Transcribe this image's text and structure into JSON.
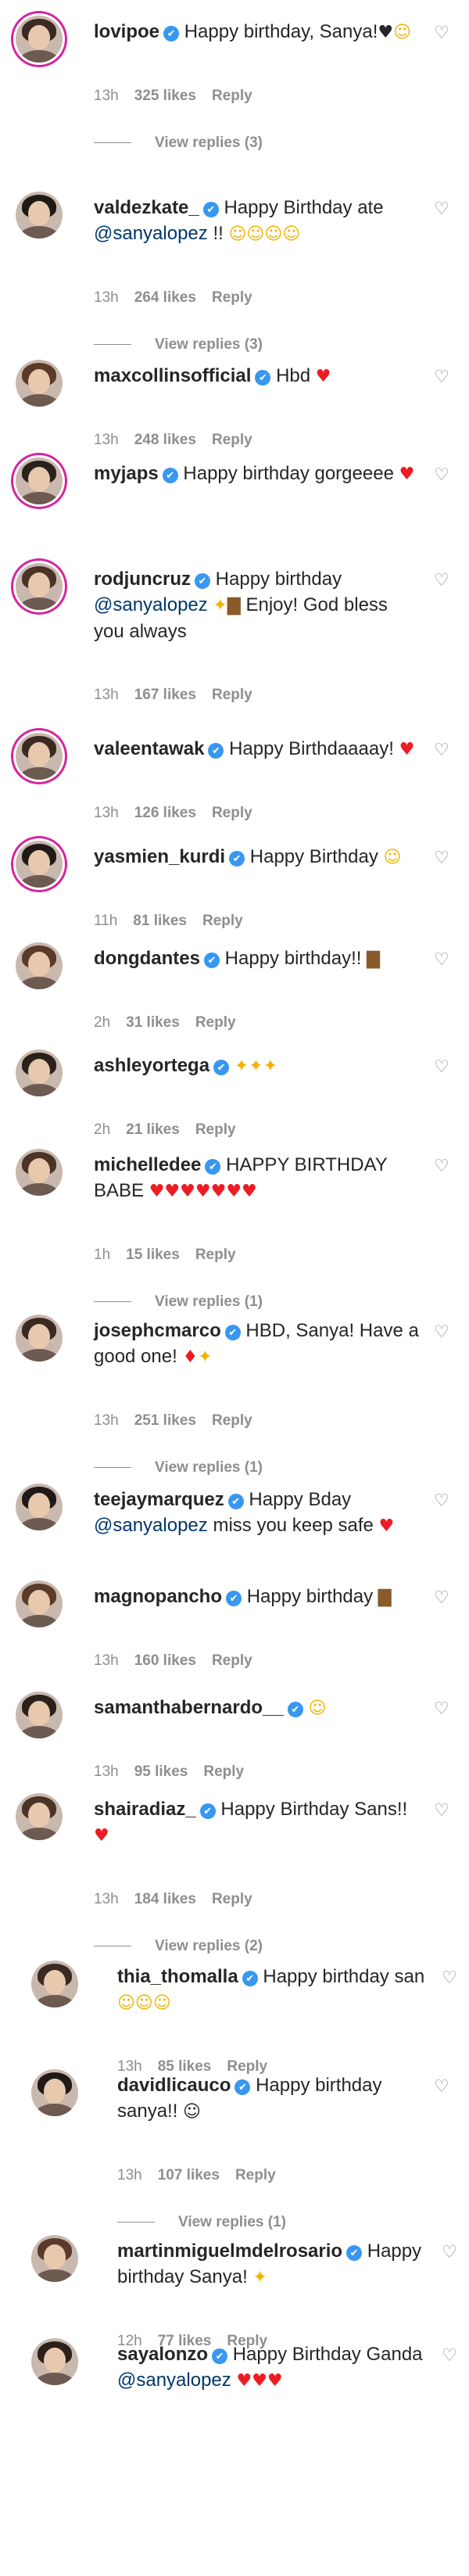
{
  "comments": [
    {
      "username": "lovipoe",
      "verified": true,
      "segments": [
        {
          "t": "Happy birthday, Sanya!"
        },
        {
          "t": "♥",
          "c": "emoji"
        },
        {
          "t": "☺",
          "c": "emoji yellow"
        }
      ],
      "time": "13h",
      "likes": "325 likes",
      "reply": "Reply",
      "view_replies": "View replies (3)"
    },
    {
      "username": "valdezkate_",
      "verified": true,
      "segments": [
        {
          "t": "Happy Birthday ate "
        },
        {
          "t": "@sanyalopez",
          "c": "mention"
        },
        {
          "t": " !! "
        },
        {
          "t": "☺☺☺☺",
          "c": "emoji yellow"
        }
      ],
      "time": "13h",
      "likes": "264 likes",
      "reply": "Reply",
      "view_replies": "View replies (3)"
    },
    {
      "username": "maxcollinsofficial",
      "verified": true,
      "segments": [
        {
          "t": "Hbd "
        },
        {
          "t": "♥",
          "c": "emoji red"
        }
      ],
      "time": "13h",
      "likes": "248 likes",
      "reply": "Reply"
    },
    {
      "username": "myjaps",
      "verified": true,
      "segments": [
        {
          "t": "Happy birthday gorgeeee "
        },
        {
          "t": "♥",
          "c": "emoji red"
        }
      ]
    },
    {
      "username": "rodjuncruz",
      "verified": true,
      "segments": [
        {
          "t": "Happy birthday "
        },
        {
          "t": "@sanyalopez",
          "c": "mention"
        },
        {
          "t": " "
        },
        {
          "t": "✦",
          "c": "emoji yellow"
        },
        {
          "t": "▇",
          "c": "emoji brown"
        },
        {
          "t": " Enjoy! God bless you always"
        }
      ],
      "time": "13h",
      "likes": "167 likes",
      "reply": "Reply"
    },
    {
      "username": "valeentawak",
      "verified": true,
      "segments": [
        {
          "t": "Happy Birthdaaaay! "
        },
        {
          "t": "♥",
          "c": "emoji red"
        }
      ],
      "time": "13h",
      "likes": "126 likes",
      "reply": "Reply"
    },
    {
      "username": "yasmien_kurdi",
      "verified": true,
      "segments": [
        {
          "t": "Happy Birthday "
        },
        {
          "t": "☺",
          "c": "emoji yellow"
        }
      ],
      "time": "11h",
      "likes": "81 likes",
      "reply": "Reply"
    },
    {
      "username": "dongdantes",
      "verified": true,
      "segments": [
        {
          "t": "Happy birthday!! "
        },
        {
          "t": "▇",
          "c": "emoji brown"
        }
      ],
      "time": "2h",
      "likes": "31 likes",
      "reply": "Reply"
    },
    {
      "username": "ashleyortega",
      "verified": true,
      "segments": [
        {
          "t": "✦✦✦",
          "c": "emoji yellow"
        }
      ],
      "time": "2h",
      "likes": "21 likes",
      "reply": "Reply"
    },
    {
      "username": "michelledee",
      "verified": true,
      "segments": [
        {
          "t": "HAPPY BIRTHDAY BABE "
        },
        {
          "t": "♥♥♥♥♥♥♥",
          "c": "emoji red"
        }
      ],
      "time": "1h",
      "likes": "15 likes",
      "reply": "Reply",
      "view_replies": "View replies (1)"
    },
    {
      "username": "josephcmarco",
      "verified": true,
      "segments": [
        {
          "t": "HBD, Sanya! Have a good one! "
        },
        {
          "t": "♦",
          "c": "emoji red"
        },
        {
          "t": "✦",
          "c": "emoji yellow"
        }
      ],
      "time": "13h",
      "likes": "251 likes",
      "reply": "Reply",
      "view_replies": "View replies (1)"
    },
    {
      "username": "teejaymarquez",
      "verified": true,
      "segments": [
        {
          "t": "Happy Bday "
        },
        {
          "t": "@sanyalopez",
          "c": "mention"
        },
        {
          "t": " miss you keep safe "
        },
        {
          "t": "♥",
          "c": "emoji red"
        }
      ]
    },
    {
      "username": "magnopancho",
      "verified": true,
      "segments": [
        {
          "t": "Happy birthday "
        },
        {
          "t": "▇",
          "c": "emoji brown"
        }
      ],
      "time": "13h",
      "likes": "160 likes",
      "reply": "Reply"
    },
    {
      "username": "samanthabernardo__",
      "verified": true,
      "segments": [
        {
          "t": "☺",
          "c": "emoji yellow"
        }
      ],
      "time": "13h",
      "likes": "95 likes",
      "reply": "Reply"
    },
    {
      "username": "shairadiaz_",
      "verified": true,
      "segments": [
        {
          "t": "Happy Birthday Sans!!"
        },
        {
          "t": "♥",
          "c": "emoji red"
        }
      ],
      "time": "13h",
      "likes": "184 likes",
      "reply": "Reply",
      "view_replies": "View replies (2)"
    },
    {
      "username": "thia_thomalla",
      "verified": true,
      "segments": [
        {
          "t": "Happy birthday san"
        },
        {
          "t": "☺☺☺",
          "c": "emoji yellow"
        }
      ],
      "time": "13h",
      "likes": "85 likes",
      "reply": "Reply"
    },
    {
      "username": "davidlicauco",
      "verified": true,
      "segments": [
        {
          "t": "Happy birthday sanya!! "
        },
        {
          "t": "☺",
          "c": "emoji"
        }
      ],
      "time": "13h",
      "likes": "107 likes",
      "reply": "Reply",
      "view_replies": "View replies (1)"
    },
    {
      "username": "martinmiguelmdelrosario",
      "verified": true,
      "segments": [
        {
          "t": "Happy birthday Sanya! "
        },
        {
          "t": "✦",
          "c": "emoji yellow"
        }
      ],
      "time": "12h",
      "likes": "77 likes",
      "reply": "Reply"
    },
    {
      "username": "sayalonzo",
      "verified": true,
      "segments": [
        {
          "t": "Happy Birthday Ganda "
        },
        {
          "t": "@sanyalopez",
          "c": "mention"
        },
        {
          "t": " "
        },
        {
          "t": "♥♥♥",
          "c": "emoji red"
        }
      ]
    }
  ],
  "icons": {
    "verified": "✔",
    "like": "♡"
  },
  "colors": {
    "verified": "#3897f0",
    "mention": "#00376b",
    "meta": "#8e8e8e",
    "story_ring": "#d6249f",
    "heart": "#ed1c24"
  }
}
